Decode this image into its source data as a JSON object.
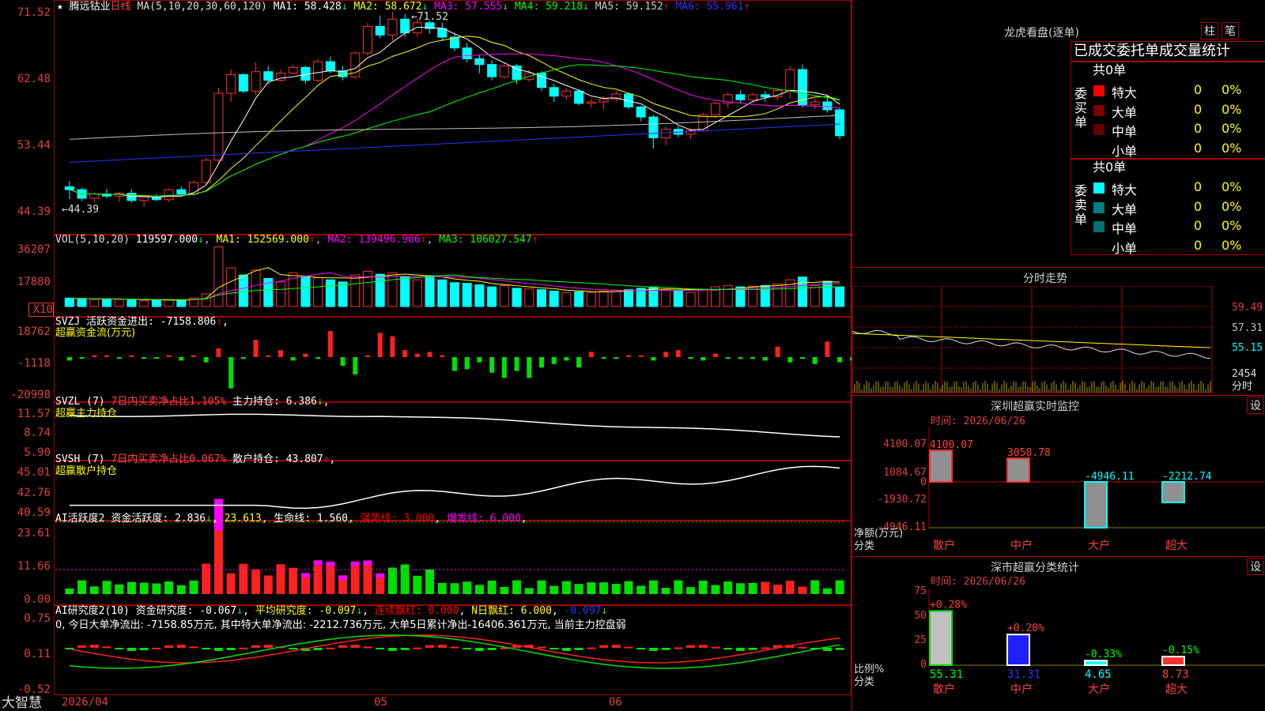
{
  "stock": {
    "star": "★",
    "name": "腾远钴业",
    "period": "日线"
  },
  "ma_header": {
    "params": "MA(5,10,20,30,60,120)",
    "items": [
      {
        "label": "MA1: 58.428",
        "arrow": "↓",
        "color": "#ffffff"
      },
      {
        "label": "MA2: 58.672",
        "arrow": "↓",
        "color": "#ffff00"
      },
      {
        "label": "MA3: 57.555",
        "arrow": "↓",
        "color": "#ff00ff"
      },
      {
        "label": "MA4: 59.218",
        "arrow": "↓",
        "color": "#00ff00"
      },
      {
        "label": "MA5: 59.152",
        "arrow": "↑",
        "color": "#c0c0c0"
      },
      {
        "label": "MA6: 55.961",
        "arrow": "↑",
        "color": "#0000ff"
      }
    ]
  },
  "price_axis": [
    "71.52",
    "62.48",
    "53.44",
    "44.39"
  ],
  "price_annot": {
    "high": "71.52",
    "low": "44.39"
  },
  "vol_header": {
    "params": "VOL(5,10,20)",
    "value": "119597.000",
    "ma1": "MA1: 152569.000",
    "ma2": "MA2: 139496.906",
    "ma3": "MA3: 106027.547"
  },
  "vol_axis": [
    "36207",
    "17880",
    "X10"
  ],
  "svzj": {
    "line1": "SVZJ  活跃资金进出: -7158.806",
    "line2": "超赢资金流(万元)",
    "axis": [
      "18762",
      "-1118",
      "-20998"
    ]
  },
  "svzl": {
    "name": "SVZL (7)",
    "ratio": "7日内买卖净占比1.105%",
    "hold": "主力持仓: 6.386",
    "line2": "超赢主力持仓",
    "axis": [
      "11.57",
      "8.74",
      "5.90"
    ]
  },
  "svsh": {
    "name": "SVSH (7)",
    "ratio": "7日内买卖净占比0.067%",
    "hold": "散户持仓: 43.807",
    "line2": "超赢散户持仓",
    "axis": [
      "45.01",
      "42.76",
      "40.59"
    ]
  },
  "ai1": {
    "name": "AI活跃度2",
    "v1": "资金活跃度: 2.836",
    "v2": "23.613",
    "v3": "生命线: 1.560",
    "v4": "强势线: 3.000",
    "v5": "爆发线: 6.000",
    "axis": [
      "23.61",
      "11.66",
      "0.00"
    ]
  },
  "ai2": {
    "name": "AI研究度2(10)",
    "v1": "资金研究度: -0.067",
    "v2": "平均研究度: -0.097",
    "v3": "连续飘红: 0.000",
    "v4": "N日飘红: 6.000",
    "v5": "-0.097",
    "note": "0, 今日大单净流出: -7158.85万元, 其中特大单净流出: -2212.736万元, 大单5日累计净出-16406.361万元, 当前主力控盘弱",
    "axis": [
      "0.75",
      "0.11",
      "-0.52"
    ]
  },
  "bottom": {
    "brand": "大智慧",
    "date_start": "2026/04",
    "m05": "05",
    "m06": "06"
  },
  "right": {
    "lhb": {
      "title": "龙虎看盘(逐单)",
      "btn1": "柱",
      "btn2": "笔",
      "tabs": "已成交委托单成交量统计",
      "buy": {
        "side": "委买单",
        "total": "共0单",
        "rows": [
          {
            "name": "特大",
            "n": "0",
            "p": "0%",
            "c": "#ff0000"
          },
          {
            "name": "大单",
            "n": "0",
            "p": "0%",
            "c": "#800000"
          },
          {
            "name": "中单",
            "n": "0",
            "p": "0%",
            "c": "#600000"
          },
          {
            "name": "小单",
            "n": "0",
            "p": "0%",
            "c": "#000000"
          }
        ]
      },
      "sell": {
        "side": "委卖单",
        "total": "共0单",
        "rows": [
          {
            "name": "特大",
            "n": "0",
            "p": "0%",
            "c": "#00ffff"
          },
          {
            "name": "大单",
            "n": "0",
            "p": "0%",
            "c": "#008080"
          },
          {
            "name": "中单",
            "n": "0",
            "p": "0%",
            "c": "#007070"
          },
          {
            "name": "小单",
            "n": "0",
            "p": "0%",
            "c": "#000000"
          }
        ]
      }
    },
    "fenshi": {
      "title": "分时走势",
      "axis": [
        "59.49",
        "57.31",
        "55.15"
      ],
      "vol": "2454",
      "unit": "分时"
    },
    "monitor": {
      "title": "深圳超赢实时监控",
      "btn": "设",
      "time": "时间: 2026/06/26",
      "axis": [
        "4100.07",
        "1084.67",
        "0",
        "-1930.72",
        "-4946.11"
      ],
      "unit1": "净额(万元)",
      "unit2": "分类"
    },
    "classify": {
      "title": "深市超赢分类统计",
      "btn": "设",
      "time": "时间: 2026/06/26",
      "axis": [
        "75",
        "50",
        "25",
        "0"
      ],
      "unit1": "比例%",
      "unit2": "分类"
    }
  },
  "chart_data": [
    {
      "type": "candlestick",
      "title": "腾远钴业 日线",
      "ylim": [
        44.39,
        71.52
      ],
      "high_label": 71.52,
      "low_label": 44.39,
      "ohlc": [
        [
          47.2,
          48.0,
          45.5,
          46.8
        ],
        [
          46.8,
          47.1,
          45.2,
          45.6
        ],
        [
          45.6,
          46.4,
          45.0,
          46.2
        ],
        [
          46.2,
          46.9,
          45.6,
          45.9
        ],
        [
          45.9,
          46.5,
          45.1,
          46.3
        ],
        [
          46.3,
          46.8,
          45.0,
          45.3
        ],
        [
          45.3,
          46.0,
          44.39,
          45.7
        ],
        [
          45.7,
          46.2,
          45.2,
          45.4
        ],
        [
          45.4,
          47.0,
          45.1,
          46.8
        ],
        [
          46.8,
          47.3,
          46.0,
          46.2
        ],
        [
          46.2,
          48.1,
          46.0,
          47.8
        ],
        [
          47.8,
          51.2,
          47.5,
          50.9
        ],
        [
          50.9,
          61.0,
          50.5,
          60.2
        ],
        [
          60.2,
          63.5,
          59.0,
          62.8
        ],
        [
          62.8,
          63.0,
          60.2,
          60.5
        ],
        [
          60.5,
          64.5,
          60.0,
          63.2
        ],
        [
          63.2,
          64.0,
          61.5,
          62.0
        ],
        [
          62.0,
          63.5,
          61.8,
          63.0
        ],
        [
          63.0,
          64.2,
          62.8,
          63.8
        ],
        [
          63.8,
          64.0,
          61.5,
          62.0
        ],
        [
          62.0,
          65.0,
          61.8,
          64.6
        ],
        [
          64.6,
          65.3,
          63.0,
          63.3
        ],
        [
          63.3,
          64.0,
          62.0,
          62.5
        ],
        [
          62.5,
          66.0,
          62.2,
          65.8
        ],
        [
          65.8,
          70.0,
          65.5,
          69.5
        ],
        [
          69.5,
          71.0,
          67.8,
          68.3
        ],
        [
          68.3,
          71.52,
          67.5,
          70.5
        ],
        [
          70.5,
          71.2,
          68.0,
          68.6
        ],
        [
          68.6,
          70.5,
          68.0,
          70.0
        ],
        [
          70.0,
          70.3,
          68.5,
          69.2
        ],
        [
          69.2,
          70.0,
          67.5,
          68.0
        ],
        [
          68.0,
          68.5,
          66.0,
          66.5
        ],
        [
          66.5,
          67.2,
          64.5,
          65.0
        ],
        [
          65.0,
          65.5,
          63.0,
          64.2
        ],
        [
          64.2,
          64.8,
          62.0,
          62.5
        ],
        [
          62.5,
          64.5,
          62.2,
          64.0
        ],
        [
          64.0,
          64.3,
          61.5,
          62.1
        ],
        [
          62.1,
          63.5,
          61.8,
          63.0
        ],
        [
          63.0,
          63.3,
          60.5,
          61.0
        ],
        [
          61.0,
          61.5,
          59.0,
          59.8
        ],
        [
          59.8,
          60.9,
          59.3,
          60.5
        ],
        [
          60.5,
          60.8,
          58.5,
          58.8
        ],
        [
          58.8,
          59.5,
          58.2,
          59.0
        ],
        [
          59.0,
          59.8,
          58.0,
          59.4
        ],
        [
          59.4,
          60.5,
          59.0,
          60.1
        ],
        [
          60.1,
          60.3,
          58.0,
          58.3
        ],
        [
          58.3,
          58.5,
          56.3,
          56.9
        ],
        [
          56.9,
          57.2,
          52.5,
          54.0
        ],
        [
          54.0,
          55.5,
          53.0,
          55.2
        ],
        [
          55.2,
          55.6,
          54.1,
          54.5
        ],
        [
          54.5,
          55.3,
          53.8,
          55.0
        ],
        [
          55.0,
          57.5,
          54.8,
          57.2
        ],
        [
          57.2,
          59.0,
          56.8,
          58.8
        ],
        [
          58.8,
          60.3,
          58.2,
          60.0
        ],
        [
          60.0,
          60.6,
          58.8,
          59.3
        ],
        [
          59.3,
          60.3,
          58.9,
          60.0
        ],
        [
          60.0,
          60.5,
          59.0,
          59.7
        ],
        [
          59.7,
          61.0,
          59.2,
          60.6
        ],
        [
          60.6,
          64.0,
          59.5,
          63.5
        ],
        [
          63.5,
          64.2,
          58.2,
          58.6
        ],
        [
          58.6,
          59.4,
          58.0,
          59.0
        ],
        [
          59.0,
          59.8,
          57.5,
          57.9
        ],
        [
          57.9,
          58.2,
          53.8,
          54.3
        ]
      ]
    },
    {
      "type": "bar",
      "title": "VOL(5,10,20)",
      "ylim": [
        0,
        36207
      ],
      "values": [
        12,
        11,
        10,
        11,
        10,
        9,
        8,
        9,
        10,
        9,
        12,
        18,
        85,
        55,
        45,
        52,
        40,
        35,
        48,
        42,
        41,
        38,
        35,
        45,
        50,
        46,
        48,
        42,
        38,
        44,
        38,
        34,
        33,
        31,
        28,
        30,
        26,
        25,
        24,
        22,
        20,
        21,
        20,
        22,
        23,
        24,
        26,
        28,
        24,
        22,
        20,
        24,
        28,
        30,
        28,
        29,
        30,
        32,
        38,
        42,
        30,
        36,
        28
      ]
    },
    {
      "type": "bar",
      "title": "超赢资金流",
      "values": [
        -2,
        0,
        1,
        1,
        0,
        1,
        0,
        -1,
        1,
        -2,
        1,
        -3,
        5,
        -18,
        -1,
        10,
        1,
        4,
        -2,
        2,
        -1,
        15,
        -5,
        -10,
        1,
        14,
        12,
        4,
        2,
        3,
        1,
        -8,
        -7,
        -3,
        -9,
        -12,
        -8,
        -12,
        -6,
        -4,
        -2,
        -6,
        3,
        0,
        -1,
        1,
        1,
        -2,
        3,
        4,
        -1,
        -2,
        2,
        0,
        -1,
        -1,
        -2,
        6,
        -3,
        -1,
        -4,
        9,
        -3,
        -2,
        -8
      ]
    }
  ]
}
